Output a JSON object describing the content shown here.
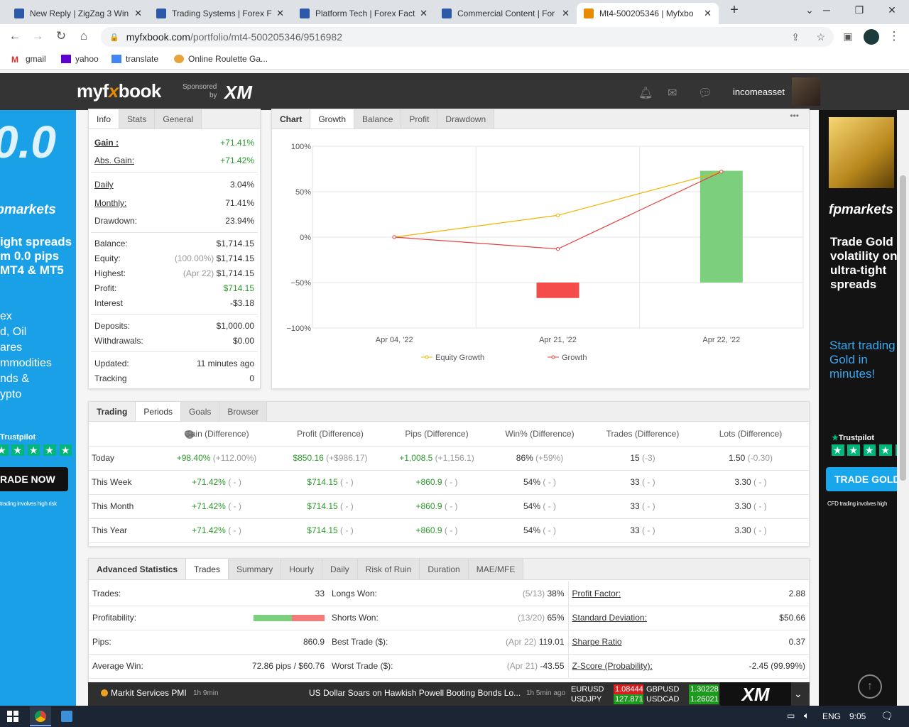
{
  "browser": {
    "tabs": [
      {
        "title": "New Reply | ZigZag 3 Win",
        "favicon": "forexfactory-icon"
      },
      {
        "title": "Trading Systems | Forex Fa",
        "favicon": "forexfactory-icon"
      },
      {
        "title": "Platform Tech | Forex Fact",
        "favicon": "forexfactory-icon"
      },
      {
        "title": "Commercial Content | For",
        "favicon": "forexfactory-icon"
      },
      {
        "title": "Mt4-500205346 | Myfxbo",
        "favicon": "myfxbook-icon"
      }
    ],
    "url_host": "myfxbook.com",
    "url_path": "/portfolio/mt4-500205346/9516982",
    "bookmarks": [
      "gmail",
      "yahoo",
      "translate",
      "Online Roulette Ga..."
    ]
  },
  "site": {
    "logo_left": "myf",
    "logo_mid": "x",
    "logo_right": "book",
    "sponsored_line1": "Sponsored",
    "sponsored_line2": "by",
    "sponsor": "XM",
    "username": "incomeasset"
  },
  "ad_left": {
    "big": "0.0",
    "brand": "fpmarkets",
    "headline": [
      "ight spreads",
      "m 0.0 pips",
      "MT4 & MT5"
    ],
    "list": [
      "ex",
      "d, Oil",
      "ares",
      "mmodities",
      "nds &",
      "ypto"
    ],
    "trustpilot": "Trustpilot",
    "cta": "RADE NOW",
    "risk": "trading involves high risk"
  },
  "ad_right": {
    "brand": "fpmarkets",
    "headline": [
      "Trade Gold",
      "volatility on",
      "ultra-tight",
      "spreads"
    ],
    "sub": [
      "Start trading",
      "Gold in",
      "minutes!"
    ],
    "trustpilot": "Trustpilot",
    "cta": "TRADE GOLD",
    "risk": "CFD trading involves high"
  },
  "info": {
    "tabs": [
      "Info",
      "Stats",
      "General"
    ],
    "gain_label": "Gain :",
    "gain": "+71.41%",
    "abs_gain_label": "Abs. Gain:",
    "abs_gain": "+71.42%",
    "daily_label": "Daily",
    "daily": "3.04%",
    "monthly_label": "Monthly:",
    "monthly": "71.41%",
    "drawdown_label": "Drawdown:",
    "drawdown": "23.94%",
    "balance_label": "Balance:",
    "balance": "$1,714.15",
    "equity_label": "Equity:",
    "equity_pct": "(100.00%)",
    "equity": "$1,714.15",
    "highest_label": "Highest:",
    "highest_date": "(Apr 22)",
    "highest": "$1,714.15",
    "profit_label": "Profit:",
    "profit": "$714.15",
    "interest_label": "Interest",
    "interest": "-$3.18",
    "deposits_label": "Deposits:",
    "deposits": "$1,000.00",
    "withdrawals_label": "Withdrawals:",
    "withdrawals": "$0.00",
    "updated_label": "Updated:",
    "updated": "11 minutes ago",
    "tracking_label": "Tracking",
    "tracking": "0"
  },
  "chart_panel": {
    "tabs": [
      "Chart",
      "Growth",
      "Balance",
      "Profit",
      "Drawdown"
    ],
    "more": "•••"
  },
  "chart_data": {
    "type": "line",
    "categories": [
      "Apr 04, '22",
      "Apr 21, '22",
      "Apr 22, '22"
    ],
    "yticks": [
      "100%",
      "50%",
      "0%",
      "−50%",
      "−100%"
    ],
    "ylim": [
      -100,
      100
    ],
    "series": [
      {
        "name": "Equity Growth",
        "type": "line",
        "color": "#f0b400",
        "values": [
          0,
          24,
          72
        ]
      },
      {
        "name": "Growth",
        "type": "line",
        "color": "#e84040",
        "values": [
          0,
          -13,
          72
        ]
      }
    ],
    "bars": [
      {
        "category": "Apr 21, '22",
        "from": -50,
        "to": -67,
        "color": "#f44b4b"
      },
      {
        "category": "Apr 22, '22",
        "from": -50,
        "to": 73,
        "color": "#7ccf7c"
      }
    ],
    "grid": true,
    "legend": "bottom"
  },
  "periods": {
    "tabs": [
      "Trading",
      "Periods",
      "Goals",
      "Browser"
    ],
    "headers": [
      "Gain (Difference)",
      "Profit (Difference)",
      "Pips (Difference)",
      "Win% (Difference)",
      "Trades (Difference)",
      "Lots (Difference)"
    ],
    "rows": [
      {
        "period": "Today",
        "gain": "+98.40%",
        "gain_d": "(+112.00%)",
        "profit": "$850.16",
        "profit_d": "(+$986.17)",
        "pips": "+1,008.5",
        "pips_d": "(+1,156.1)",
        "win": "86%",
        "win_d": "(+59%)",
        "trades": "15",
        "trades_d": "(-3)",
        "lots": "1.50",
        "lots_d": "(-0.30)"
      },
      {
        "period": "This Week",
        "gain": "+71.42%",
        "gain_d": "( - )",
        "profit": "$714.15",
        "profit_d": "( - )",
        "pips": "+860.9",
        "pips_d": "( - )",
        "win": "54%",
        "win_d": "( - )",
        "trades": "33",
        "trades_d": "( - )",
        "lots": "3.30",
        "lots_d": "( - )"
      },
      {
        "period": "This Month",
        "gain": "+71.42%",
        "gain_d": "( - )",
        "profit": "$714.15",
        "profit_d": "( - )",
        "pips": "+860.9",
        "pips_d": "( - )",
        "win": "54%",
        "win_d": "( - )",
        "trades": "33",
        "trades_d": "( - )",
        "lots": "3.30",
        "lots_d": "( - )"
      },
      {
        "period": "This Year",
        "gain": "+71.42%",
        "gain_d": "( - )",
        "profit": "$714.15",
        "profit_d": "( - )",
        "pips": "+860.9",
        "pips_d": "( - )",
        "win": "54%",
        "win_d": "( - )",
        "trades": "33",
        "trades_d": "( - )",
        "lots": "3.30",
        "lots_d": "( - )"
      }
    ]
  },
  "advanced": {
    "tabs": [
      "Advanced Statistics",
      "Trades",
      "Summary",
      "Hourly",
      "Daily",
      "Risk of Ruin",
      "Duration",
      "MAE/MFE"
    ],
    "rows": [
      {
        "l1": "Trades:",
        "v1": "33",
        "l2": "Longs Won:",
        "v2a": "(5/13)",
        "v2": "38%",
        "l3": "Profit Factor:",
        "v3": "2.88"
      },
      {
        "l1": "Profitability:",
        "v1": "",
        "l2": "Shorts Won:",
        "v2a": "(13/20)",
        "v2": "65%",
        "l3": "Standard Deviation:",
        "v3": "$50.66"
      },
      {
        "l1": "Pips:",
        "v1": "860.9",
        "l2": "Best Trade ($):",
        "v2a": "(Apr 22)",
        "v2": "119.01",
        "l3": "Sharpe Ratio",
        "v3": "0.37"
      },
      {
        "l1": "Average Win:",
        "v1": "72.86 pips / $60.76",
        "l2": "Worst Trade ($):",
        "v2a": "(Apr 21)",
        "v2": "-43.55",
        "l3": "Z-Score (Probability):",
        "v3": "-2.45 (99.99%)"
      }
    ],
    "profitability_win_pct": 0.54
  },
  "news": {
    "item1": "Markit Services PMI",
    "item1_time": "1h 9min",
    "item2": "US Dollar Soars on Hawkish Powell Booting Bonds Lo...",
    "item2_time": "1h 5min ago",
    "quotes": [
      {
        "pair": "EURUSD",
        "price": "1.08444",
        "color": "#d42020"
      },
      {
        "pair": "GBPUSD",
        "price": "1.30228",
        "color": "#1e9a1e"
      },
      {
        "pair": "USDJPY",
        "price": "127.871",
        "color": "#1e9a1e"
      },
      {
        "pair": "USDCAD",
        "price": "1.26021",
        "color": "#1e9a1e"
      }
    ],
    "broker": "XM"
  },
  "taskbar": {
    "lang": "ENG",
    "time": "9:05"
  }
}
